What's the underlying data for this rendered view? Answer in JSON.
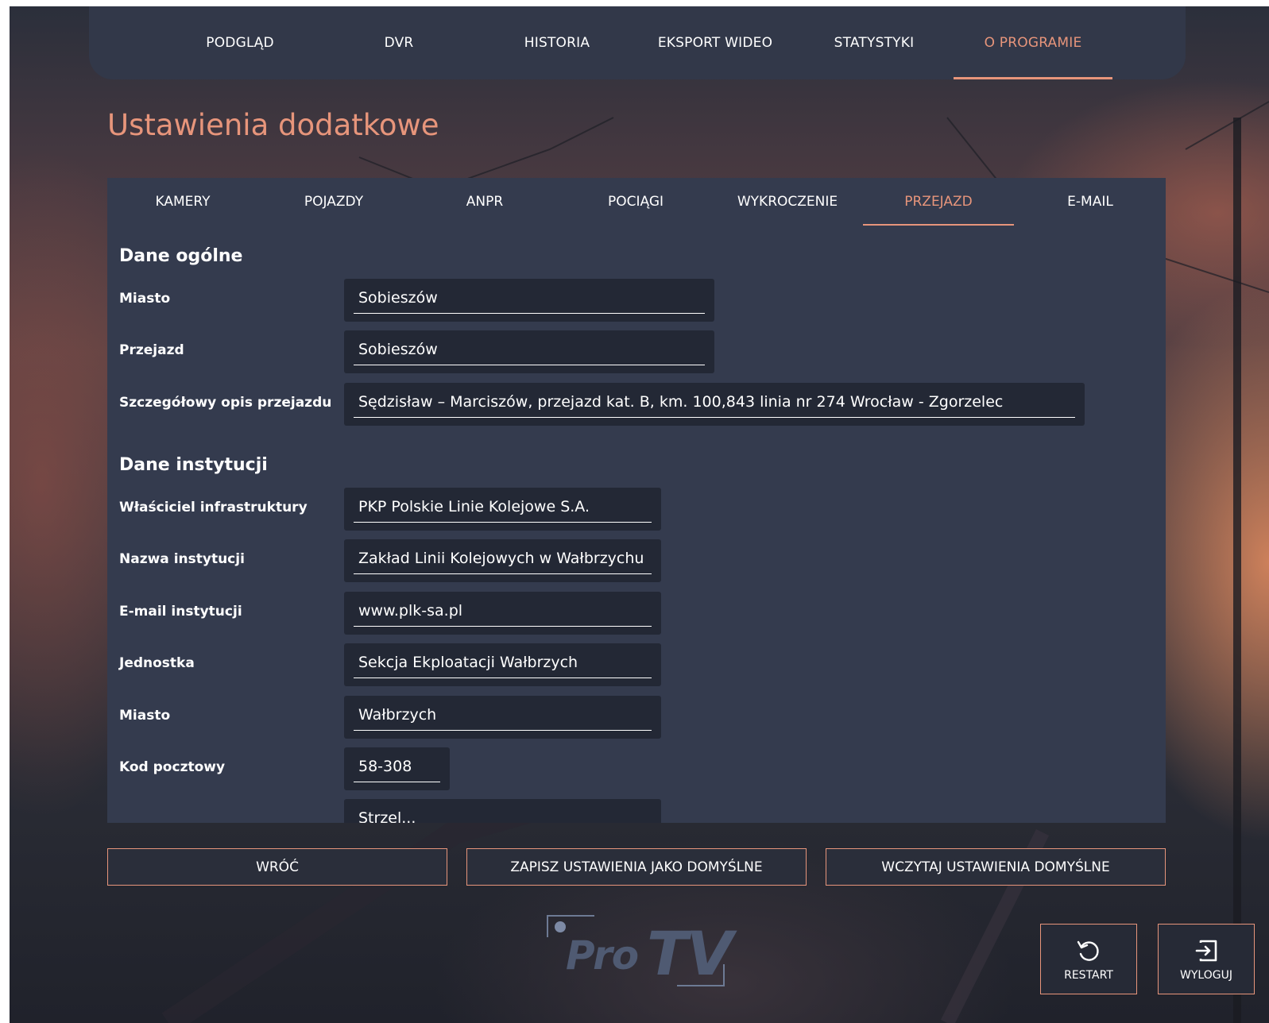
{
  "colors": {
    "accent": "#e7957b",
    "panel": "#343b4e",
    "field_bg": "#232835",
    "nav_bg": "#323849"
  },
  "nav": {
    "tabs": [
      {
        "label": "PODGLĄD"
      },
      {
        "label": "DVR"
      },
      {
        "label": "HISTORIA"
      },
      {
        "label": "EKSPORT WIDEO"
      },
      {
        "label": "STATYSTYKI"
      },
      {
        "label": "O PROGRAMIE"
      }
    ],
    "active": "O PROGRAMIE"
  },
  "page": {
    "title": "Ustawienia dodatkowe"
  },
  "subtabs": {
    "items": [
      {
        "label": "KAMERY"
      },
      {
        "label": "POJAZDY"
      },
      {
        "label": "ANPR"
      },
      {
        "label": "POCIĄGI"
      },
      {
        "label": "WYKROCZENIE"
      },
      {
        "label": "PRZEJAZD"
      },
      {
        "label": "E-MAIL"
      }
    ],
    "active": "PRZEJAZD"
  },
  "general": {
    "title": "Dane ogólne",
    "miasto": {
      "label": "Miasto",
      "value": "Sobieszów"
    },
    "przejazd": {
      "label": "Przejazd",
      "value": "Sobieszów"
    },
    "opis": {
      "label": "Szczegółowy opis przejazdu",
      "value": "Sędzisław – Marciszów, przejazd kat. B, km. 100,843 linia nr 274 Wrocław - Zgorzelec"
    }
  },
  "institution": {
    "title": "Dane instytucji",
    "wlasciciel": {
      "label": "Właściciel infrastruktury",
      "value": "PKP Polskie Linie Kolejowe S.A."
    },
    "nazwa": {
      "label": "Nazwa instytucji",
      "value": "Zakład Linii Kolejowych w Wałbrzychu"
    },
    "email": {
      "label": "E-mail instytucji",
      "value": "www.plk-sa.pl"
    },
    "jednostka": {
      "label": "Jednostka",
      "value": "Sekcja Ekploatacji Wałbrzych"
    },
    "miasto": {
      "label": "Miasto",
      "value": "Wałbrzych"
    },
    "kod": {
      "label": "Kod pocztowy",
      "value": "58-308"
    },
    "next": {
      "value": "Strzel..."
    }
  },
  "actions": {
    "back": "WRÓĆ",
    "save_default": "ZAPISZ USTAWIENIA JAKO DOMYŚLNE",
    "load_default": "WCZYTAJ USTAWIENIA DOMYŚLNE"
  },
  "logo": {
    "part1": "Pro",
    "part2": "TV"
  },
  "system": {
    "restart": {
      "label": "RESTART",
      "icon": "restart-icon"
    },
    "logout": {
      "label": "WYLOGUJ",
      "icon": "logout-icon"
    }
  }
}
